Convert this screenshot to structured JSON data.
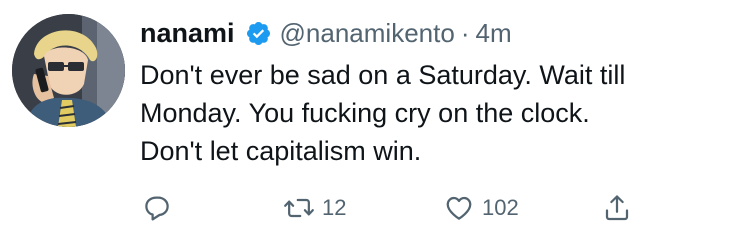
{
  "tweet": {
    "author": {
      "display_name": "nanami",
      "handle": "@nanamikento",
      "verified": true,
      "avatar_icon": "user-avatar-anime-character"
    },
    "separator": "·",
    "timestamp": "4m",
    "text_lines": [
      "Don't ever be sad on a Saturday. Wait till",
      "Monday. You fucking cry on the clock.",
      "Don't let capitalism win."
    ],
    "actions": {
      "reply": {
        "icon": "reply-icon",
        "count": ""
      },
      "retweet": {
        "icon": "retweet-icon",
        "count": "12"
      },
      "like": {
        "icon": "heart-icon",
        "count": "102"
      },
      "share": {
        "icon": "share-icon",
        "count": ""
      }
    }
  },
  "colors": {
    "text_primary": "#0f1419",
    "text_secondary": "#536471",
    "verified_badge": "#1d9bf0",
    "background": "#ffffff"
  }
}
